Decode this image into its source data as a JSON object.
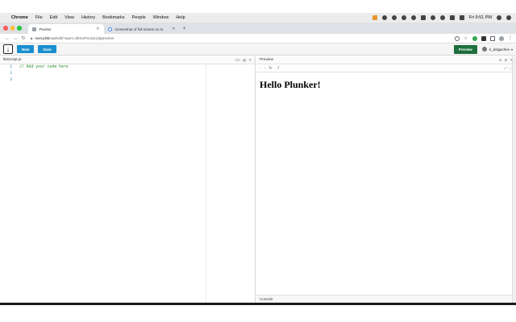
{
  "menubar": {
    "app": "Chrome",
    "items": [
      "File",
      "Edit",
      "View",
      "History",
      "Bookmarks",
      "People",
      "Window",
      "Help"
    ],
    "clock": "Fri 9:51 PM"
  },
  "tabs": [
    {
      "title": "Plunker",
      "active": true
    },
    {
      "title": "screenshot of full screen on m",
      "active": false
    }
  ],
  "address": {
    "host": "next.plnkr.co",
    "path": "/edit/?open=lib%2Fscript.js&preview"
  },
  "header": {
    "new_label": "New",
    "save_label": "Save",
    "preview_label": "Preview",
    "username": "k_dolgachev"
  },
  "editor": {
    "filename": "lib/script.js",
    "line_numbers": [
      "1",
      "2",
      "3"
    ],
    "lines": [
      "// Add your code here",
      "",
      ""
    ]
  },
  "preview": {
    "title": "Preview",
    "path": "/",
    "heading": "Hello Plunker!",
    "console_label": "Console"
  },
  "colors": {
    "accent_blue": "#1b8fcf",
    "preview_green": "#1e6e3e",
    "comment_green": "#2a8a2a"
  }
}
